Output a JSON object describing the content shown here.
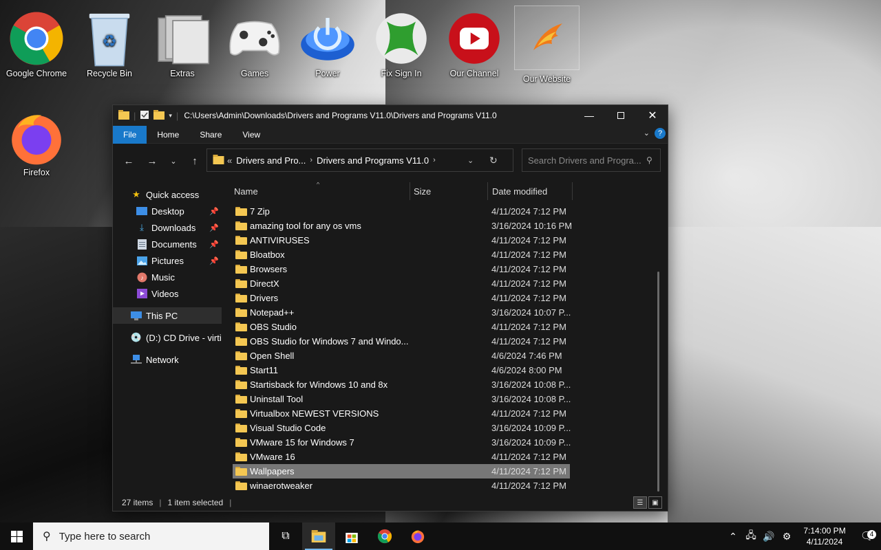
{
  "desktop": {
    "icons": [
      {
        "label": "Google Chrome"
      },
      {
        "label": "Recycle Bin"
      },
      {
        "label": "Extras"
      },
      {
        "label": "Games"
      },
      {
        "label": "Power"
      },
      {
        "label": "Fix Sign In"
      },
      {
        "label": "Our Channel"
      },
      {
        "label": "Our Website"
      },
      {
        "label": "Firefox"
      }
    ]
  },
  "window": {
    "title": "C:\\Users\\Admin\\Downloads\\Drivers and Programs V11.0\\Drivers and Programs V11.0",
    "ribbon": {
      "file": "File",
      "home": "Home",
      "share": "Share",
      "view": "View"
    },
    "address": {
      "prefix": "«",
      "crumb1": "Drivers and Pro...",
      "crumb2": "Drivers and Programs V11.0"
    },
    "search_placeholder": "Search Drivers and Progra...",
    "nav": {
      "quick_access": "Quick access",
      "desktop": "Desktop",
      "downloads": "Downloads",
      "documents": "Documents",
      "pictures": "Pictures",
      "music": "Music",
      "videos": "Videos",
      "this_pc": "This PC",
      "cd_drive": "(D:) CD Drive - virtio",
      "network": "Network"
    },
    "columns": {
      "name": "Name",
      "size": "Size",
      "date": "Date modified"
    },
    "files": [
      {
        "name": "7 Zip",
        "date": "4/11/2024 7:12 PM"
      },
      {
        "name": "amazing tool for any os vms",
        "date": "3/16/2024 10:16 PM"
      },
      {
        "name": "ANTIVIRUSES",
        "date": "4/11/2024 7:12 PM"
      },
      {
        "name": "Bloatbox",
        "date": "4/11/2024 7:12 PM"
      },
      {
        "name": "Browsers",
        "date": "4/11/2024 7:12 PM"
      },
      {
        "name": "DirectX",
        "date": "4/11/2024 7:12 PM"
      },
      {
        "name": "Drivers",
        "date": "4/11/2024 7:12 PM"
      },
      {
        "name": "Notepad++",
        "date": "3/16/2024 10:07 P..."
      },
      {
        "name": "OBS Studio",
        "date": "4/11/2024 7:12 PM"
      },
      {
        "name": "OBS Studio for Windows 7 and Windo...",
        "date": "4/11/2024 7:12 PM"
      },
      {
        "name": "Open Shell",
        "date": "4/6/2024 7:46 PM"
      },
      {
        "name": "Start11",
        "date": "4/6/2024 8:00 PM"
      },
      {
        "name": "Startisback for Windows 10 and 8x",
        "date": "3/16/2024 10:08 P..."
      },
      {
        "name": "Uninstall Tool",
        "date": "3/16/2024 10:08 P..."
      },
      {
        "name": "Virtualbox NEWEST VERSIONS",
        "date": "4/11/2024 7:12 PM"
      },
      {
        "name": "Visual Studio Code",
        "date": "3/16/2024 10:09 P..."
      },
      {
        "name": "VMware 15 for Windows 7",
        "date": "3/16/2024 10:09 P..."
      },
      {
        "name": "VMware 16",
        "date": "4/11/2024 7:12 PM"
      },
      {
        "name": "Wallpapers",
        "date": "4/11/2024 7:12 PM",
        "selected": true
      },
      {
        "name": "winaerotweaker",
        "date": "4/11/2024 7:12 PM"
      }
    ],
    "status": {
      "items": "27 items",
      "selected": "1 item selected"
    }
  },
  "taskbar": {
    "search_placeholder": "Type here to search",
    "time": "7:14:00 PM",
    "date": "4/11/2024",
    "notifications": "4"
  },
  "colors": {
    "accent": "#1979ca",
    "folder": "#f4c752",
    "window_bg": "#191919"
  }
}
